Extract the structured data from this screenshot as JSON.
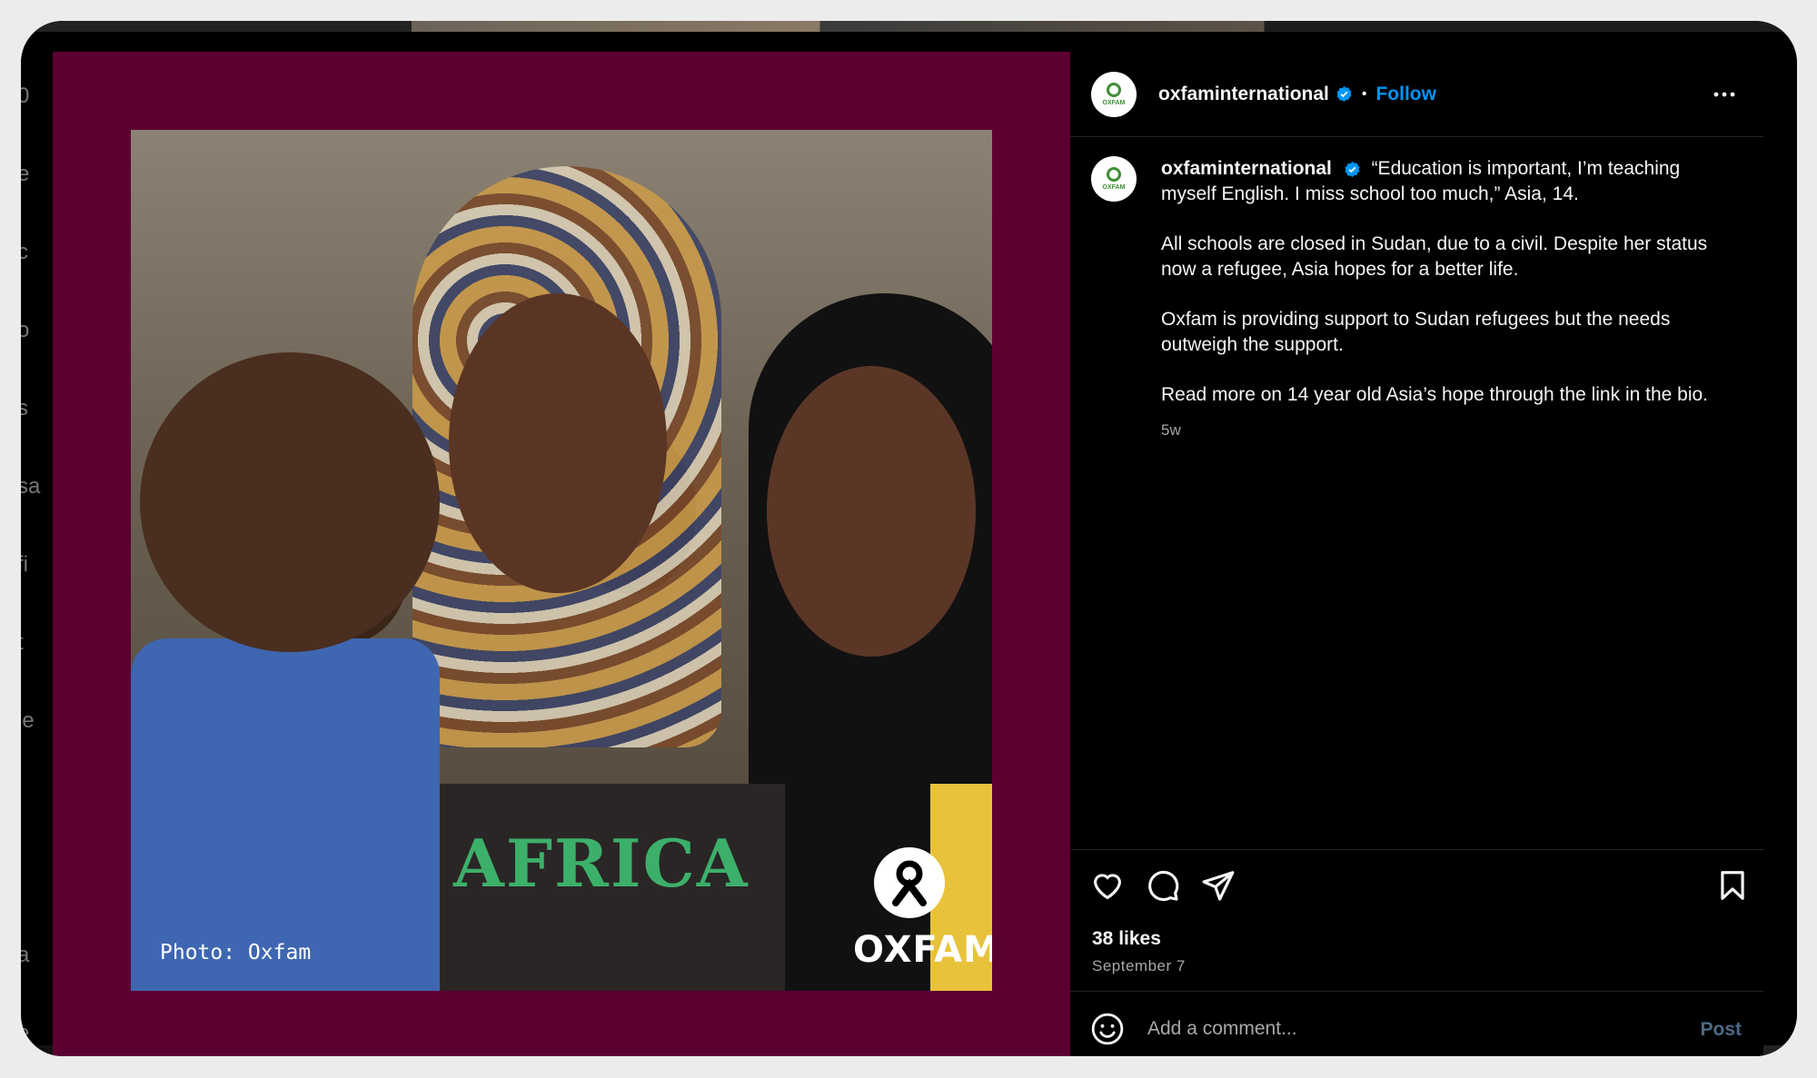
{
  "post": {
    "username": "oxfaminternational",
    "follow_label": "Follow",
    "dot": "•",
    "avatar_label": "OXFAM",
    "caption_paragraphs": [
      "“Education is important, I’m teaching myself English. I miss school too much,” Asia, 14.",
      "All schools are closed in Sudan, due to a civil. Despite her status now a refugee, Asia hopes for a better life.",
      "Oxfam is providing support to Sudan refugees but the needs outweigh the support.",
      "Read more on 14 year old Asia’s hope through the link in the bio."
    ],
    "time_ago": "5w",
    "likes": "38 likes",
    "date": "September 7"
  },
  "media": {
    "photo_credit": "Photo: Oxfam",
    "logo_text": "OXFAM",
    "shirt_text": "AFRICA",
    "border_color": "#5c0031"
  },
  "comment": {
    "placeholder": "Add a comment...",
    "post_label": "Post"
  },
  "background_page": {
    "edge_letters": [
      "0",
      "e",
      "c",
      "o",
      "s",
      "sa",
      "fi",
      "t",
      "le",
      "a",
      "e"
    ]
  },
  "colors": {
    "follow": "#0095f6",
    "verified": "#0095f6",
    "post_disabled": "#4d6a85"
  },
  "icons": [
    "heart-icon",
    "comment-icon",
    "share-icon",
    "bookmark-icon",
    "more-options-icon",
    "emoji-icon",
    "verified-badge-icon"
  ]
}
